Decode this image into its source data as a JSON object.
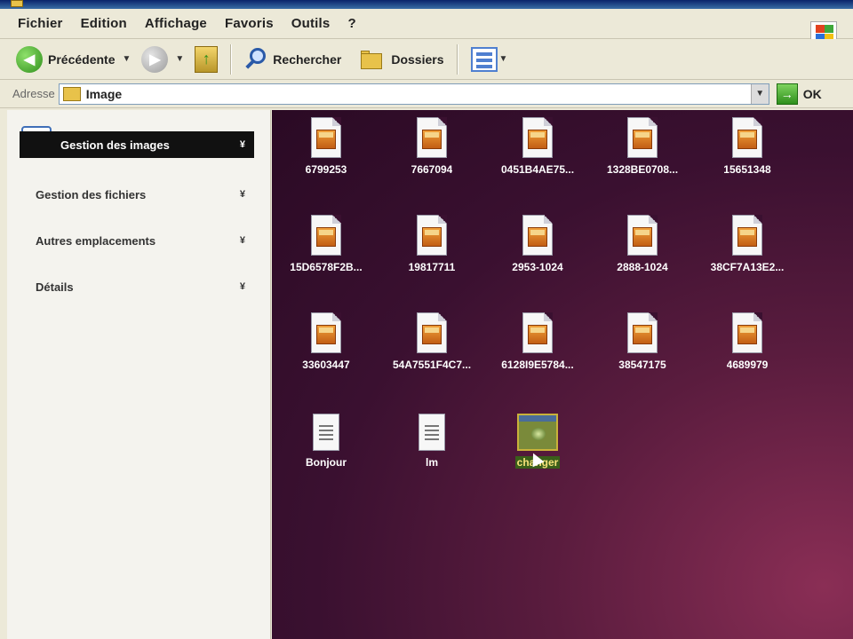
{
  "menu": [
    "Fichier",
    "Edition",
    "Affichage",
    "Favoris",
    "Outils",
    "?"
  ],
  "toolbar": {
    "back_label": "Précédente",
    "search_label": "Rechercher",
    "folders_label": "Dossiers"
  },
  "address": {
    "label": "Adresse",
    "value": "Image",
    "go_label": "OK"
  },
  "taskpane": {
    "sections": [
      {
        "label": "Gestion des images",
        "expanded_marker": "¥"
      },
      {
        "label": "Gestion des fichiers",
        "expanded_marker": "¥"
      },
      {
        "label": "Autres emplacements",
        "expanded_marker": "¥"
      },
      {
        "label": "Détails",
        "expanded_marker": "¥"
      }
    ]
  },
  "files": [
    {
      "name": "6799253",
      "type": "image"
    },
    {
      "name": "7667094",
      "type": "image"
    },
    {
      "name": "0451B4AE75...",
      "type": "image"
    },
    {
      "name": "1328BE0708...",
      "type": "image"
    },
    {
      "name": "15651348",
      "type": "image"
    },
    {
      "name": "15D6578F2B...",
      "type": "image"
    },
    {
      "name": "19817711",
      "type": "image"
    },
    {
      "name": "2953-1024",
      "type": "image"
    },
    {
      "name": "2888-1024",
      "type": "image"
    },
    {
      "name": "38CF7A13E2...",
      "type": "image"
    },
    {
      "name": "33603447",
      "type": "image"
    },
    {
      "name": "54A7551F4C7...",
      "type": "image"
    },
    {
      "name": "6128I9E5784...",
      "type": "image"
    },
    {
      "name": "38547175",
      "type": "image"
    },
    {
      "name": "4689979",
      "type": "image"
    },
    {
      "name": "Bonjour",
      "type": "document"
    },
    {
      "name": "lm",
      "type": "document"
    },
    {
      "name": "changer",
      "type": "shortcut",
      "selected": true
    }
  ],
  "colors": {
    "content_bg": "#3a1030",
    "selection_text": "#f8e27a"
  }
}
